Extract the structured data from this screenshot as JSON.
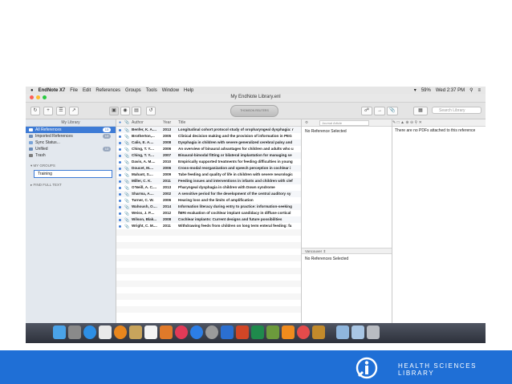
{
  "menubar": {
    "items": [
      "EndNote X7",
      "File",
      "Edit",
      "References",
      "Groups",
      "Tools",
      "Window",
      "Help"
    ],
    "battery": "59%",
    "clock": "Wed 2:37 PM"
  },
  "window": {
    "title": "My EndNote Library.enl"
  },
  "toolbar": {
    "online_badge": "THOMSON REUTERS",
    "search_placeholder": "Search Library"
  },
  "sidebar": {
    "header": "My Library",
    "items": [
      {
        "label": "All References",
        "count": "13"
      },
      {
        "label": "Imported References",
        "count": "13"
      },
      {
        "label": "Sync Status...",
        "count": ""
      },
      {
        "label": "Unfiled",
        "count": "13"
      },
      {
        "label": "Trash",
        "count": ""
      }
    ],
    "groups_heading": "MY GROUPS",
    "new_group_value": "Training",
    "find_full_text": "FIND FULL TEXT"
  },
  "reflist": {
    "columns": {
      "author": "Author",
      "year": "Year",
      "title": "Title"
    },
    "rows": [
      {
        "author": "Benfer, K. A....",
        "year": "2013",
        "title": "Longitudinal cohort protocol study of oropharyngeal dysphagia: r"
      },
      {
        "author": "Brotherton,...",
        "year": "2005",
        "title": "Clinical decision making and the provision of information in PEG"
      },
      {
        "author": "Calis, E. A....",
        "year": "2008",
        "title": "Dysphagia in children with severe generalized cerebral palsy and"
      },
      {
        "author": "Ching, T. Y....",
        "year": "2006",
        "title": "An overview of binaural advantages for children and adults who u"
      },
      {
        "author": "Ching, T. Y....",
        "year": "2007",
        "title": "Binaural-bimodal fitting or bilateral implantation for managing se"
      },
      {
        "author": "Davis, A. M....",
        "year": "2010",
        "title": "Empirically supported treatments for feeding difficulties in young"
      },
      {
        "author": "Doucet, M....",
        "year": "2006",
        "title": "Cross-modal reorganization and speech perception in cochlear i"
      },
      {
        "author": "Mahant, S....",
        "year": "2009",
        "title": "Tube feeding and quality of life in children with severe neurologic"
      },
      {
        "author": "Miller, C. K.",
        "year": "2011",
        "title": "Feeding issues and interventions in infants and children with clef"
      },
      {
        "author": "O'Neill, A. C....",
        "year": "2013",
        "title": "Pharyngeal dysphagia in children with Down syndrome"
      },
      {
        "author": "Sharma, A....",
        "year": "2002",
        "title": "A sensitive period for the development of the central auditory sy"
      },
      {
        "author": "Turner, C. W.",
        "year": "2006",
        "title": "Hearing loss and the limits of amplification"
      },
      {
        "author": "Wahoush, O....",
        "year": "2014",
        "title": "Information literacy during entry to practice: information-seeking"
      },
      {
        "author": "Weiss, J. P....",
        "year": "2012",
        "title": "fMRI evaluation of cochlear implant candidacy in diffuse cortical"
      },
      {
        "author": "Wilson, Blak...",
        "year": "2008",
        "title": "Cochlear implants: Current designs and future possibilities"
      },
      {
        "author": "Wright, C. M....",
        "year": "2011",
        "title": "Withdrawing feeds from children on long term enteral feeding: fa"
      }
    ]
  },
  "reference_pane": {
    "type_select": "Journal Article",
    "message": "No Reference Selected",
    "style_select": "Vancouver",
    "style_message": "No References Selected"
  },
  "pdf_pane": {
    "message": "There are no PDFs attached to this reference"
  },
  "footer": {
    "logo_line1": "HEALTH SCIENCES",
    "logo_line2": "LIBRARY"
  },
  "colors": {
    "footer_blue": "#1f6fd6",
    "selection_blue": "#3d7bd6"
  }
}
